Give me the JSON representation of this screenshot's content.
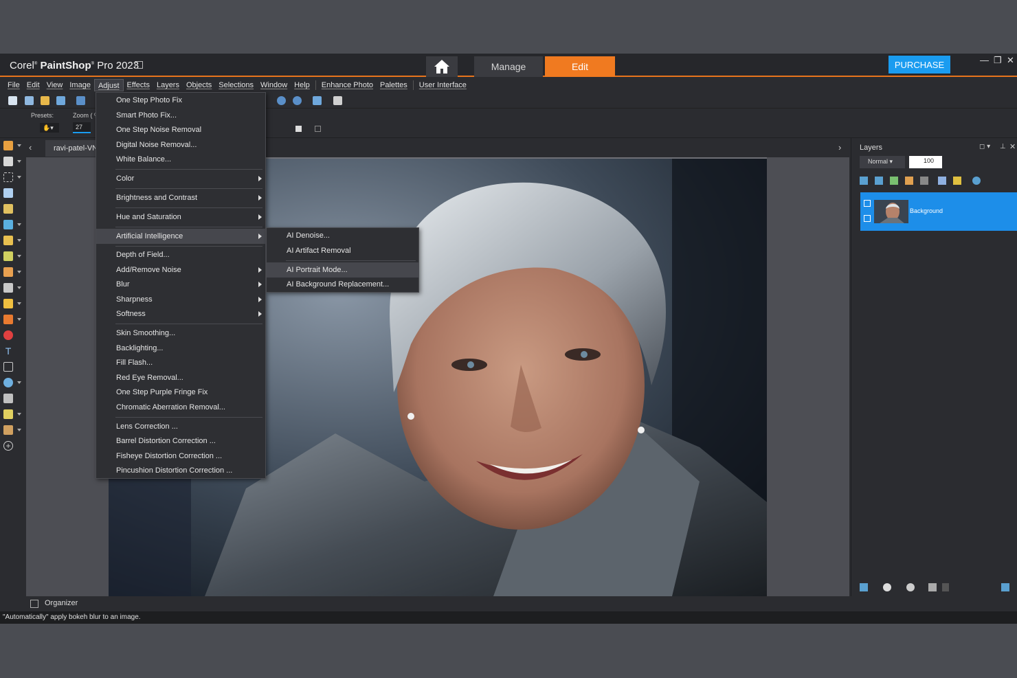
{
  "app": {
    "title_brand": "Corel",
    "title_product": "PaintShop",
    "title_suffix": "Pro 2023"
  },
  "header": {
    "manage_label": "Manage",
    "edit_label": "Edit",
    "purchase_label": "PURCHASE"
  },
  "menubar": [
    "File",
    "Edit",
    "View",
    "Image",
    "Adjust",
    "Effects",
    "Layers",
    "Objects",
    "Selections",
    "Window",
    "Help",
    "Enhance Photo",
    "Palettes",
    "User Interface"
  ],
  "options": {
    "presets_label": "Presets:",
    "zoom_label": "Zoom ( %",
    "zoom_value": "27"
  },
  "document": {
    "tab_label": "ravi-patel-VN"
  },
  "adjust_menu": {
    "items": [
      "One Step Photo Fix",
      "Smart Photo Fix...",
      "One Step Noise Removal",
      "Digital Noise Removal...",
      "White Balance...",
      "Color",
      "Brightness and Contrast",
      "Hue and Saturation",
      "Artificial Intelligence",
      "Depth of Field...",
      "Add/Remove Noise",
      "Blur",
      "Sharpness",
      "Softness",
      "Skin Smoothing...",
      "Backlighting...",
      "Fill Flash...",
      "Red Eye Removal...",
      "One Step Purple Fringe Fix",
      "Chromatic Aberration Removal...",
      "Lens Correction ...",
      "Barrel Distortion Correction ...",
      "Fisheye Distortion Correction ...",
      "Pincushion Distortion Correction ..."
    ]
  },
  "ai_submenu": {
    "items": [
      "AI Denoise...",
      "AI Artifact Removal",
      "AI Portrait Mode...",
      "AI Background Replacement..."
    ]
  },
  "layers_panel": {
    "title": "Layers",
    "blend_mode": "Normal",
    "opacity": "100",
    "layer_name": "Background"
  },
  "organizer": {
    "label": "Organizer"
  },
  "status": {
    "text": "\"Automatically\" apply bokeh blur to an image."
  },
  "colors": {
    "accent_orange": "#f07a20",
    "purchase_blue": "#1a9cf0",
    "layer_selected": "#1d8ee9"
  }
}
